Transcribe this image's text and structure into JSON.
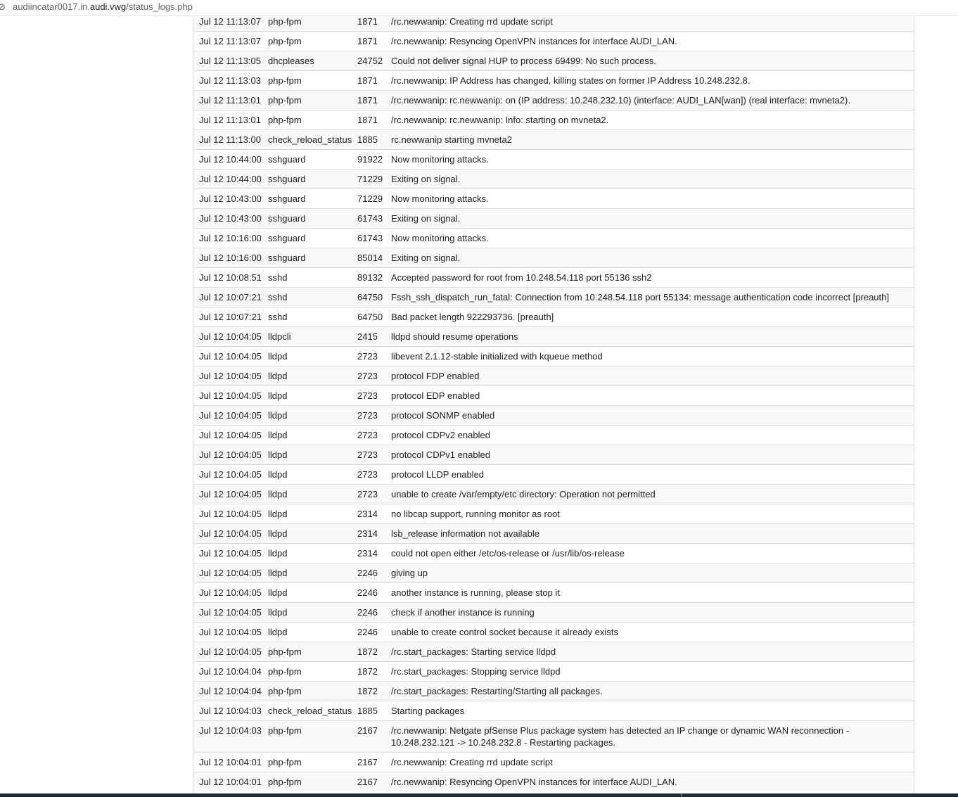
{
  "browser": {
    "lock_glyph": "⊘",
    "url_prefix": "audiincatar0017.in.",
    "url_domain": "audi.vwg",
    "url_path": "/status_logs.php"
  },
  "log": {
    "rows": [
      {
        "time": "Jul 12 11:13:07",
        "process": "php-fpm",
        "pid": "1871",
        "message": "/rc.newwanip: Creating rrd update script"
      },
      {
        "time": "Jul 12 11:13:07",
        "process": "php-fpm",
        "pid": "1871",
        "message": "/rc.newwanip: Resyncing OpenVPN instances for interface AUDI_LAN."
      },
      {
        "time": "Jul 12 11:13:05",
        "process": "dhcpleases",
        "pid": "24752",
        "message": "Could not deliver signal HUP to process 69499: No such process."
      },
      {
        "time": "Jul 12 11:13:03",
        "process": "php-fpm",
        "pid": "1871",
        "message": "/rc.newwanip: IP Address has changed, killing states on former IP Address 10.248.232.8."
      },
      {
        "time": "Jul 12 11:13:01",
        "process": "php-fpm",
        "pid": "1871",
        "message": "/rc.newwanip: rc.newwanip: on (IP address: 10.248.232.10) (interface: AUDI_LAN[wan]) (real interface: mvneta2)."
      },
      {
        "time": "Jul 12 11:13:01",
        "process": "php-fpm",
        "pid": "1871",
        "message": "/rc.newwanip: rc.newwanip: Info: starting on mvneta2."
      },
      {
        "time": "Jul 12 11:13:00",
        "process": "check_reload_status",
        "pid": "1885",
        "message": "rc.newwanip starting mvneta2"
      },
      {
        "time": "Jul 12 10:44:00",
        "process": "sshguard",
        "pid": "91922",
        "message": "Now monitoring attacks."
      },
      {
        "time": "Jul 12 10:44:00",
        "process": "sshguard",
        "pid": "71229",
        "message": "Exiting on signal."
      },
      {
        "time": "Jul 12 10:43:00",
        "process": "sshguard",
        "pid": "71229",
        "message": "Now monitoring attacks."
      },
      {
        "time": "Jul 12 10:43:00",
        "process": "sshguard",
        "pid": "61743",
        "message": "Exiting on signal."
      },
      {
        "time": "Jul 12 10:16:00",
        "process": "sshguard",
        "pid": "61743",
        "message": "Now monitoring attacks."
      },
      {
        "time": "Jul 12 10:16:00",
        "process": "sshguard",
        "pid": "85014",
        "message": "Exiting on signal."
      },
      {
        "time": "Jul 12 10:08:51",
        "process": "sshd",
        "pid": "89132",
        "message": "Accepted password for root from 10.248.54.118 port 55136 ssh2"
      },
      {
        "time": "Jul 12 10:07:21",
        "process": "sshd",
        "pid": "64750",
        "message": "Fssh_ssh_dispatch_run_fatal: Connection from 10.248.54.118 port 55134: message authentication code incorrect [preauth]"
      },
      {
        "time": "Jul 12 10:07:21",
        "process": "sshd",
        "pid": "64750",
        "message": "Bad packet length 922293736. [preauth]"
      },
      {
        "time": "Jul 12 10:04:05",
        "process": "lldpcli",
        "pid": "2415",
        "message": "lldpd should resume operations"
      },
      {
        "time": "Jul 12 10:04:05",
        "process": "lldpd",
        "pid": "2723",
        "message": "libevent 2.1.12-stable initialized with kqueue method"
      },
      {
        "time": "Jul 12 10:04:05",
        "process": "lldpd",
        "pid": "2723",
        "message": "protocol FDP enabled"
      },
      {
        "time": "Jul 12 10:04:05",
        "process": "lldpd",
        "pid": "2723",
        "message": "protocol EDP enabled"
      },
      {
        "time": "Jul 12 10:04:05",
        "process": "lldpd",
        "pid": "2723",
        "message": "protocol SONMP enabled"
      },
      {
        "time": "Jul 12 10:04:05",
        "process": "lldpd",
        "pid": "2723",
        "message": "protocol CDPv2 enabled"
      },
      {
        "time": "Jul 12 10:04:05",
        "process": "lldpd",
        "pid": "2723",
        "message": "protocol CDPv1 enabled"
      },
      {
        "time": "Jul 12 10:04:05",
        "process": "lldpd",
        "pid": "2723",
        "message": "protocol LLDP enabled"
      },
      {
        "time": "Jul 12 10:04:05",
        "process": "lldpd",
        "pid": "2723",
        "message": "unable to create /var/empty/etc directory: Operation not permitted"
      },
      {
        "time": "Jul 12 10:04:05",
        "process": "lldpd",
        "pid": "2314",
        "message": "no libcap support, running monitor as root"
      },
      {
        "time": "Jul 12 10:04:05",
        "process": "lldpd",
        "pid": "2314",
        "message": "lsb_release information not available"
      },
      {
        "time": "Jul 12 10:04:05",
        "process": "lldpd",
        "pid": "2314",
        "message": "could not open either /etc/os-release or /usr/lib/os-release"
      },
      {
        "time": "Jul 12 10:04:05",
        "process": "lldpd",
        "pid": "2246",
        "message": "giving up"
      },
      {
        "time": "Jul 12 10:04:05",
        "process": "lldpd",
        "pid": "2246",
        "message": "another instance is running, please stop it"
      },
      {
        "time": "Jul 12 10:04:05",
        "process": "lldpd",
        "pid": "2246",
        "message": "check if another instance is running"
      },
      {
        "time": "Jul 12 10:04:05",
        "process": "lldpd",
        "pid": "2246",
        "message": "unable to create control socket because it already exists"
      },
      {
        "time": "Jul 12 10:04:05",
        "process": "php-fpm",
        "pid": "1872",
        "message": "/rc.start_packages: Starting service lldpd"
      },
      {
        "time": "Jul 12 10:04:04",
        "process": "php-fpm",
        "pid": "1872",
        "message": "/rc.start_packages: Stopping service lldpd"
      },
      {
        "time": "Jul 12 10:04:04",
        "process": "php-fpm",
        "pid": "1872",
        "message": "/rc.start_packages: Restarting/Starting all packages."
      },
      {
        "time": "Jul 12 10:04:03",
        "process": "check_reload_status",
        "pid": "1885",
        "message": "Starting packages"
      },
      {
        "time": "Jul 12 10:04:03",
        "process": "php-fpm",
        "pid": "2167",
        "message": "/rc.newwanip: Netgate pfSense Plus package system has detected an IP change or dynamic WAN reconnection - 10.248.232.121 -> 10.248.232.8 - Restarting packages."
      },
      {
        "time": "Jul 12 10:04:01",
        "process": "php-fpm",
        "pid": "2167",
        "message": "/rc.newwanip: Creating rrd update script"
      },
      {
        "time": "Jul 12 10:04:01",
        "process": "php-fpm",
        "pid": "2167",
        "message": "/rc.newwanip: Resyncing OpenVPN instances for interface AUDI_LAN."
      }
    ]
  }
}
